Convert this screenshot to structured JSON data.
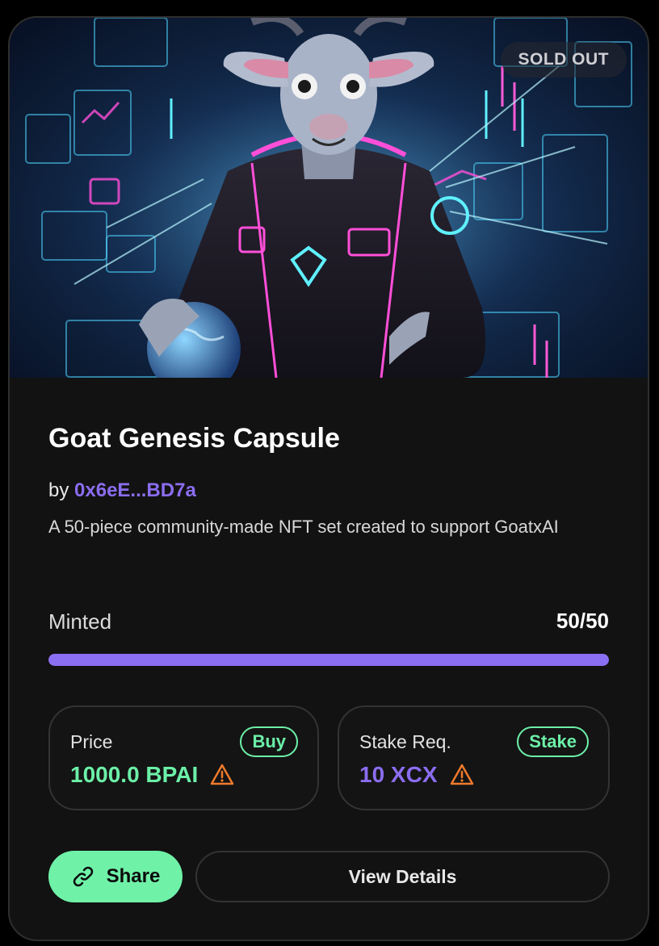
{
  "nft": {
    "status_badge": "SOLD OUT",
    "title": "Goat Genesis Capsule",
    "by_prefix": "by",
    "creator": "0x6eE...BD7a",
    "description": "A 50-piece community-made NFT set created to support GoatxAI",
    "minted_label": "Minted",
    "minted_value": "50/50",
    "minted_fraction": 1.0
  },
  "price": {
    "label": "Price",
    "action": "Buy",
    "value": "1000.0 BPAI",
    "warning_icon": "warning-triangle-icon"
  },
  "stake": {
    "label": "Stake Req.",
    "action": "Stake",
    "value": "10 XCX",
    "warning_icon": "warning-triangle-icon"
  },
  "actions": {
    "share_label": "Share",
    "share_icon": "link-icon",
    "details_label": "View Details"
  },
  "colors": {
    "accent_green": "#6cf0a8",
    "accent_purple": "#8b6df0",
    "warning_orange": "#f07a2c"
  }
}
